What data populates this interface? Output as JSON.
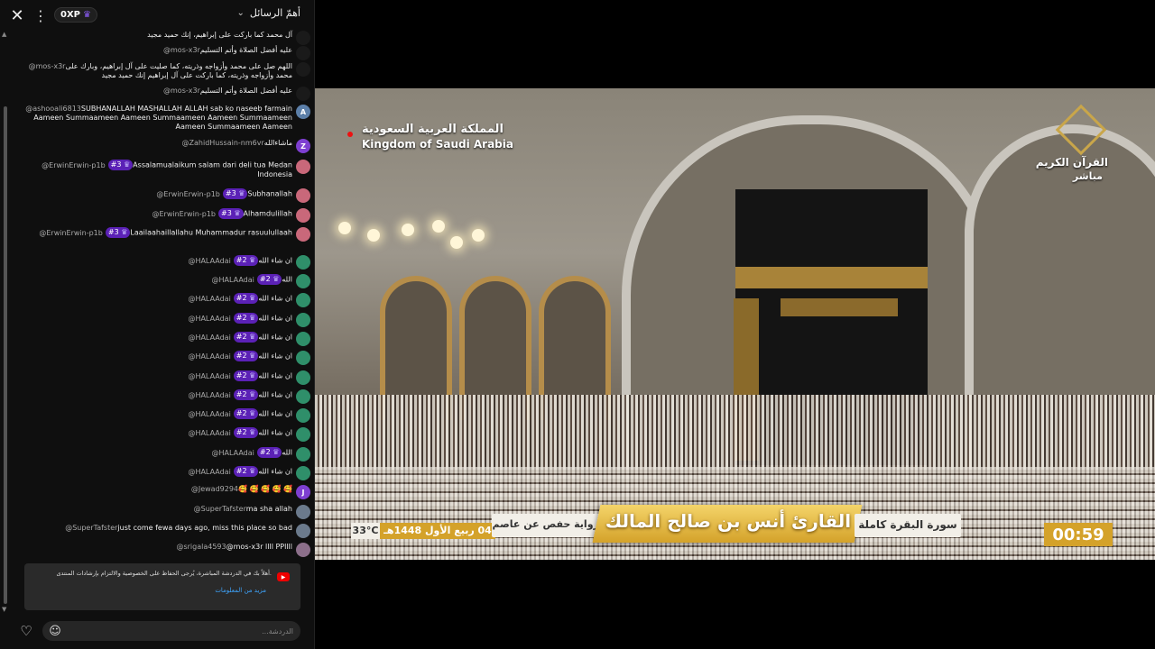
{
  "header": {
    "xp": "0XP",
    "title": "أهمّ الرسائل"
  },
  "messages": [
    {
      "author": "",
      "text": "آل محمد كما باركت على إبراهيم، إنك حميد مجيد",
      "avatar_color": "#1a1a1a",
      "avatar_letter": "",
      "rank": ""
    },
    {
      "author": "@mos-x3r",
      "text": "عليه أفضل الصلاة وأتم التسليم",
      "avatar_color": "#1a1a1a",
      "avatar_letter": "",
      "rank": ""
    },
    {
      "author": "@mos-x3r",
      "text": "اللهم صل على محمد وأزواجه وذريته، كما صليت على آل إبراهيم، وبارك على محمد وأزواجه وذريته، كما باركت على آل إبراهيم إنك حميد مجيد",
      "avatar_color": "#1a1a1a",
      "avatar_letter": "",
      "rank": ""
    },
    {
      "author": "@mos-x3r",
      "text": "عليه أفضل الصلاة وأتم التسليم",
      "avatar_color": "#1a1a1a",
      "avatar_letter": "",
      "rank": ""
    },
    {
      "author": "@ashooali6813",
      "text": "SUBHANALLAH MASHALLAH ALLAH sab ko naseeb farmain Aameen Summaameen Aameen Summaameen Aameen Summaameen Aameen Summaameen Aameen",
      "avatar_color": "#5c7fa8",
      "avatar_letter": "A",
      "rank": ""
    },
    {
      "author": "@ZahidHussain-nm6vr",
      "text": "ماشاءالله",
      "avatar_color": "#7e3fd1",
      "avatar_letter": "Z",
      "rank": ""
    },
    {
      "author": "@ErwinErwin-p1b",
      "text": "Assalamualaikum salam dari deli tua Medan Indonesia",
      "avatar_color": "#c9687a",
      "avatar_letter": "",
      "rank": "#3"
    },
    {
      "author": "@ErwinErwin-p1b",
      "text": "Subhanallah",
      "avatar_color": "#c9687a",
      "avatar_letter": "",
      "rank": "#3"
    },
    {
      "author": "@ErwinErwin-p1b",
      "text": "Alhamdulillah",
      "avatar_color": "#c9687a",
      "avatar_letter": "",
      "rank": "#3"
    },
    {
      "author": "@ErwinErwin-p1b",
      "text": "Laailaahaillallahu Muhammadur rasuulullaah",
      "avatar_color": "#c9687a",
      "avatar_letter": "",
      "rank": "#3"
    },
    {
      "author": "@HALAAdai",
      "text": "ان شاء الله",
      "avatar_color": "#2f8f6a",
      "avatar_letter": "",
      "rank": "#2"
    },
    {
      "author": "@HALAAdai",
      "text": "الله",
      "avatar_color": "#2f8f6a",
      "avatar_letter": "",
      "rank": "#2"
    },
    {
      "author": "@HALAAdai",
      "text": "ان شاء الله",
      "avatar_color": "#2f8f6a",
      "avatar_letter": "",
      "rank": "#2"
    },
    {
      "author": "@HALAAdai",
      "text": "ان شاء الله",
      "avatar_color": "#2f8f6a",
      "avatar_letter": "",
      "rank": "#2"
    },
    {
      "author": "@HALAAdai",
      "text": "ان شاء الله",
      "avatar_color": "#2f8f6a",
      "avatar_letter": "",
      "rank": "#2"
    },
    {
      "author": "@HALAAdai",
      "text": "ان شاء الله",
      "avatar_color": "#2f8f6a",
      "avatar_letter": "",
      "rank": "#2"
    },
    {
      "author": "@HALAAdai",
      "text": "ان شاء الله",
      "avatar_color": "#2f8f6a",
      "avatar_letter": "",
      "rank": "#2"
    },
    {
      "author": "@HALAAdai",
      "text": "ان شاء الله",
      "avatar_color": "#2f8f6a",
      "avatar_letter": "",
      "rank": "#2"
    },
    {
      "author": "@HALAAdai",
      "text": "ان شاء الله",
      "avatar_color": "#2f8f6a",
      "avatar_letter": "",
      "rank": "#2"
    },
    {
      "author": "@HALAAdai",
      "text": "ان شاء الله",
      "avatar_color": "#2f8f6a",
      "avatar_letter": "",
      "rank": "#2"
    },
    {
      "author": "@HALAAdai",
      "text": "الله",
      "avatar_color": "#2f8f6a",
      "avatar_letter": "",
      "rank": "#2"
    },
    {
      "author": "@HALAAdai",
      "text": "ان شاء الله",
      "avatar_color": "#2f8f6a",
      "avatar_letter": "",
      "rank": "#2"
    },
    {
      "author": "@Jewad9294",
      "text": "🥰 🥰 🥰 🥰 🥰",
      "avatar_color": "#7e3fd1",
      "avatar_letter": "J",
      "rank": ""
    },
    {
      "author": "@SuperTafster",
      "text": "ma sha allah",
      "avatar_color": "#6b7a8c",
      "avatar_letter": "",
      "rank": ""
    },
    {
      "author": "@SuperTafster",
      "text": "just come fewa days ago, miss this place so bad",
      "avatar_color": "#6b7a8c",
      "avatar_letter": "",
      "rank": ""
    },
    {
      "author": "@srigala4593",
      "text": "@mos-x3r llll PPllll",
      "avatar_color": "#8c6f8a",
      "avatar_letter": "",
      "rank": ""
    }
  ],
  "notice": {
    "text": "أهلاً بك في الدردشة المباشرة، يُرجى الحفاظ على الخصوصية والالتزام بإرشادات المنتدى.",
    "link": "مزيد من المعلومات"
  },
  "input": {
    "placeholder": "الدردشة..."
  },
  "video": {
    "kingdom_ar": "المملكة العربية السعودية",
    "kingdom_en": "Kingdom of Saudi Arabia",
    "channel_ar": "القرآن الكريم",
    "channel_live": "مباشر",
    "reader": "القارئ أنس بن صالح المالك",
    "surah": "سورة البقرة كاملة",
    "riwaya": "برواية حفص عن عاصم",
    "date": "04 ربيع الأول 1448هـ",
    "temperature": "33°C",
    "clock": "00:59"
  },
  "colors": {
    "rank_badge": "#5b21b6",
    "gold": "#d4a22a",
    "link": "#3ea6ff"
  }
}
